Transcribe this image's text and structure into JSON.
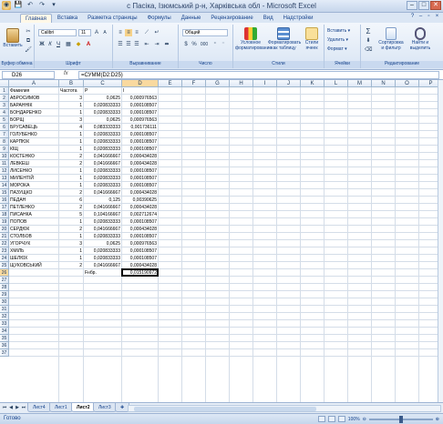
{
  "window": {
    "title": "с Пасіка, Ізюмський р-н, Харківська обл - Microsoft Excel",
    "qat": [
      "💾",
      "↶",
      "↷",
      "▾"
    ],
    "controls": {
      "min": "–",
      "max": "□",
      "close": "✕"
    }
  },
  "ribbon_tabs": [
    "Главная",
    "Вставка",
    "Разметка страницы",
    "Формулы",
    "Данные",
    "Рецензирование",
    "Вид",
    "Надстройки"
  ],
  "active_tab": "Главная",
  "ribbon": {
    "clipboard": {
      "label": "Буфер обмена",
      "paste": "Вставить"
    },
    "font": {
      "label": "Шрифт",
      "name": "Calibri",
      "size": "11",
      "bold": "Ж",
      "italic": "К",
      "underline": "Ч"
    },
    "alignment": {
      "label": "Выравнивание"
    },
    "number": {
      "label": "Число",
      "format": "Общий",
      "percent": "%",
      "thousands": "000"
    },
    "styles": {
      "label": "Стили",
      "conditional": "Условное форматирование",
      "table": "Форматировать как таблицу",
      "cell": "Стили ячеек"
    },
    "cells": {
      "label": "Ячейки",
      "insert": "Вставить",
      "delete": "Удалить",
      "format": "Формат"
    },
    "editing": {
      "label": "Редактирование",
      "sort": "Сортировка и фильтр",
      "find": "Найти и выделить",
      "sum": "Σ"
    }
  },
  "formula_bar": {
    "name_box": "D26",
    "fx": "fx",
    "formula": "=СУММ(D2:D25)"
  },
  "columns": [
    "A",
    "B",
    "C",
    "D",
    "E",
    "F",
    "G",
    "H",
    "I",
    "J",
    "K",
    "L",
    "M",
    "N",
    "O",
    "P",
    "Q"
  ],
  "selected_column": "D",
  "selected_row": 26,
  "rows": [
    {
      "n": 1,
      "a": "Фамилия",
      "b": "Частота",
      "c": "P",
      "d": "I"
    },
    {
      "n": 2,
      "a": "АБРОСИМОВ",
      "b": "3",
      "c": "0,0625",
      "d": "0,000976563"
    },
    {
      "n": 3,
      "a": "БАРАННІК",
      "b": "1",
      "c": "0,020833333",
      "d": "0,000108507"
    },
    {
      "n": 4,
      "a": "БОНДАРЕНКО",
      "b": "1",
      "c": "0,020833333",
      "d": "0,000108507"
    },
    {
      "n": 5,
      "a": "БОРЩ",
      "b": "3",
      "c": "0,0625",
      "d": "0,000976563"
    },
    {
      "n": 6,
      "a": "БРУСАВЕЦЬ",
      "b": "4",
      "c": "0,083333333",
      "d": "0,001736111"
    },
    {
      "n": 7,
      "a": "ГОЛУБЕНКО",
      "b": "1",
      "c": "0,020833333",
      "d": "0,000108507"
    },
    {
      "n": 8,
      "a": "КАРПЮК",
      "b": "1",
      "c": "0,020833333",
      "d": "0,000108507"
    },
    {
      "n": 9,
      "a": "КІЩ",
      "b": "1",
      "c": "0,020833333",
      "d": "0,000108507"
    },
    {
      "n": 10,
      "a": "КОСТЕНКО",
      "b": "2",
      "c": "0,041666667",
      "d": "0,000434028"
    },
    {
      "n": 11,
      "a": "ЛЕВКЕШ",
      "b": "2",
      "c": "0,041666667",
      "d": "0,000434028"
    },
    {
      "n": 12,
      "a": "ЛИСЕНКО",
      "b": "1",
      "c": "0,020833333",
      "d": "0,000108507"
    },
    {
      "n": 13,
      "a": "МИЛЕНТІЙ",
      "b": "1",
      "c": "0,020833333",
      "d": "0,000108507"
    },
    {
      "n": 14,
      "a": "МОРОКА",
      "b": "1",
      "c": "0,020833333",
      "d": "0,000108507"
    },
    {
      "n": 15,
      "a": "ПАЗУЩКО",
      "b": "2",
      "c": "0,041666667",
      "d": "0,000434028"
    },
    {
      "n": 16,
      "a": "ПЕДАН",
      "b": "6",
      "c": "0,125",
      "d": "0,00390625"
    },
    {
      "n": 17,
      "a": "ПЕТЛЕНКО",
      "b": "2",
      "c": "0,041666667",
      "d": "0,000434028"
    },
    {
      "n": 18,
      "a": "ПИСАНКА",
      "b": "5",
      "c": "0,104166667",
      "d": "0,002712674"
    },
    {
      "n": 19,
      "a": "ПОПОВ",
      "b": "1",
      "c": "0,020833333",
      "d": "0,000108507"
    },
    {
      "n": 20,
      "a": "СЕРДЮК",
      "b": "2",
      "c": "0,041666667",
      "d": "0,000434028"
    },
    {
      "n": 21,
      "a": "СТОЛБОВ",
      "b": "1",
      "c": "0,020833333",
      "d": "0,000108507"
    },
    {
      "n": 22,
      "a": "УГОРЧУК",
      "b": "3",
      "c": "0,0625",
      "d": "0,000976563"
    },
    {
      "n": 23,
      "a": "ХМІЛЬ",
      "b": "1",
      "c": "0,020833333",
      "d": "0,000108507"
    },
    {
      "n": 24,
      "a": "ШЕЛЮХ",
      "b": "1",
      "c": "0,020833333",
      "d": "0,000108507"
    },
    {
      "n": 25,
      "a": "ЩУКОВСЬКИЙ",
      "b": "2",
      "c": "0,041666667",
      "d": "0,000434028"
    },
    {
      "n": 26,
      "a": "",
      "b": "",
      "c": "Fнбр.",
      "d": "0,015190972"
    }
  ],
  "total_rows": 37,
  "sheets": [
    "Лист4",
    "Лист1",
    "Лист2",
    "Лист3"
  ],
  "active_sheet": "Лист2",
  "status": {
    "text": "Готово",
    "zoom": "100%"
  }
}
